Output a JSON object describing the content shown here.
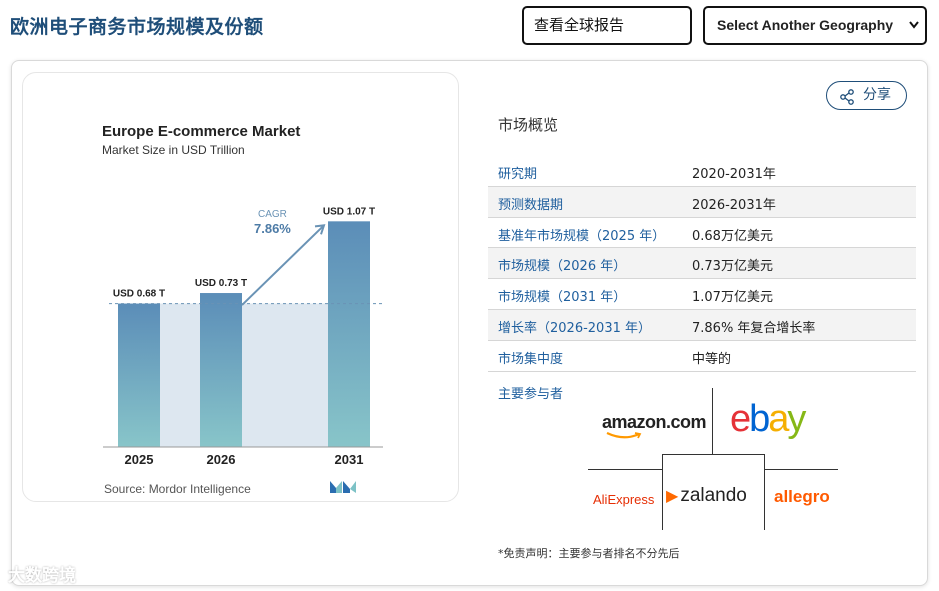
{
  "header": {
    "title": "欧洲电子商务市场规模及份额",
    "global_report_button": "查看全球报告",
    "geography_select": "Select Another Geography"
  },
  "chart_data": {
    "type": "bar",
    "title": "Europe E-commerce Market",
    "subtitle": "Market Size in USD Trillion",
    "categories": [
      "2025",
      "2026",
      "2031"
    ],
    "values": [
      0.68,
      0.73,
      1.07
    ],
    "data_labels": [
      "USD 0.68 T",
      "USD 0.73 T",
      "USD 1.07 T"
    ],
    "cagr_label": "CAGR",
    "cagr_value": "7.86%",
    "source": "Source: Mordor Intelligence",
    "ylim": [
      0,
      1.1
    ],
    "colors": {
      "bar_top": "#5b8db8",
      "bar_bottom": "#88c5c9",
      "fill_band": "#dde7f0",
      "arrow": "#6a93b5",
      "cagr_text": "#4d7ba6"
    }
  },
  "share_button": "分享",
  "overview": {
    "title": "市场概览",
    "rows": [
      {
        "label": "研究期",
        "value": "2020-2031年"
      },
      {
        "label": "预测数据期",
        "value": "2026-2031年"
      },
      {
        "label": "基准年市场规模（2025 年）",
        "value": "0.68万亿美元"
      },
      {
        "label": "市场规模（2026 年）",
        "value": "0.73万亿美元"
      },
      {
        "label": "市场规模（2031 年）",
        "value": "1.07万亿美元"
      },
      {
        "label": "增长率（2026-2031 年）",
        "value": "7.86% 年复合增长率"
      },
      {
        "label": "市场集中度",
        "value": "中等的"
      }
    ]
  },
  "players": {
    "title": "主要参与者",
    "logos": [
      "amazon.com",
      "ebay",
      "AliExpress",
      "zalando",
      "allegro"
    ]
  },
  "disclaimer": "*免责声明：主要参与者排名不分先后",
  "watermark": "大数跨境"
}
